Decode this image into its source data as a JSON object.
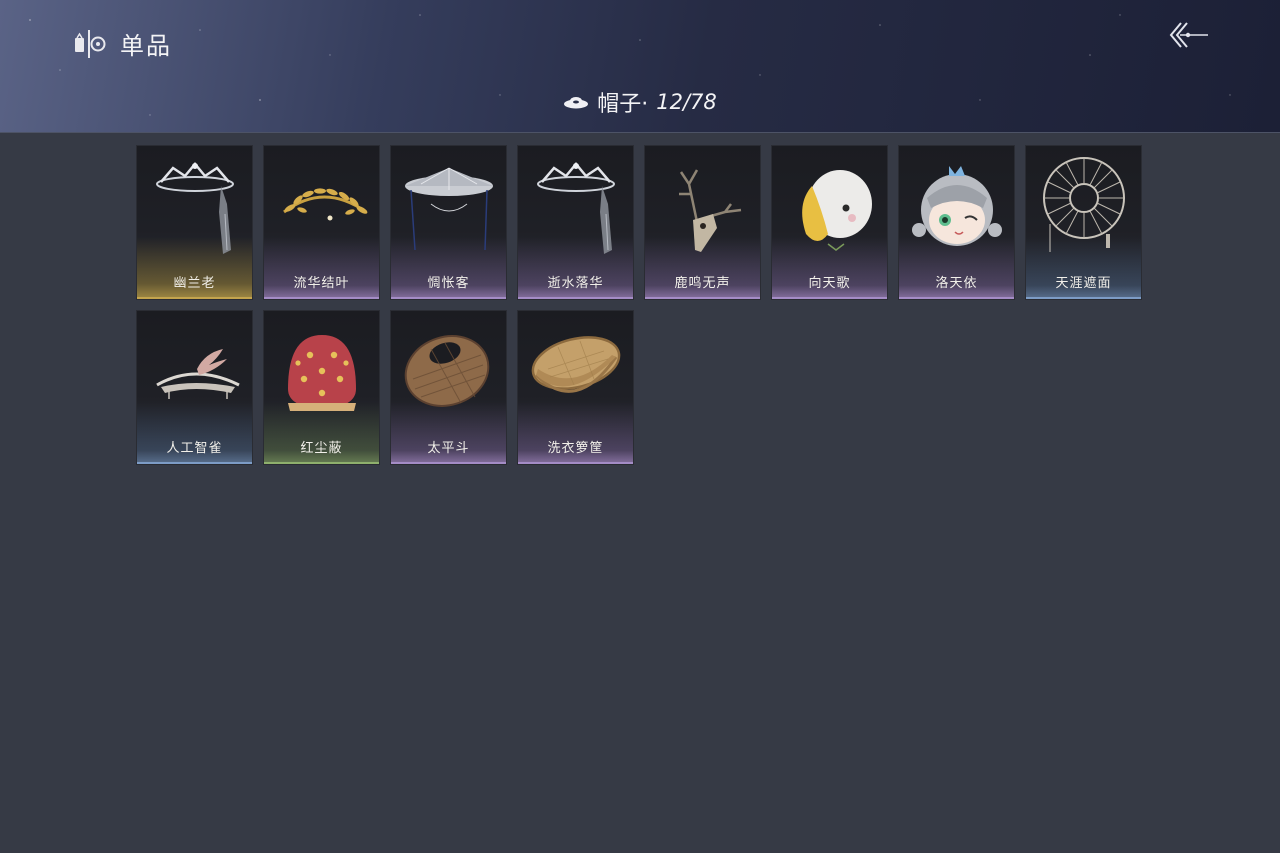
{
  "header": {
    "title": "单品",
    "logo_icon": "wardrobe-logo-icon",
    "back_icon": "back-arrow-icon"
  },
  "category": {
    "icon": "hat-icon",
    "label": "帽子·",
    "count": "12/78"
  },
  "items": [
    {
      "name": "幽兰老",
      "rarity": "gold",
      "icon": "veil-crown-hat"
    },
    {
      "name": "流华结叶",
      "rarity": "purple",
      "icon": "golden-leaf-circlet"
    },
    {
      "name": "惆怅客",
      "rarity": "purple",
      "icon": "white-bamboo-hat"
    },
    {
      "name": "逝水落华",
      "rarity": "purple",
      "icon": "veil-crown-hat"
    },
    {
      "name": "鹿鸣无声",
      "rarity": "purple",
      "icon": "antler-skull"
    },
    {
      "name": "向天歌",
      "rarity": "purple",
      "icon": "goose-plush-hat"
    },
    {
      "name": "洛天依",
      "rarity": "purple",
      "icon": "luo-tianyi-plush-hat"
    },
    {
      "name": "天涯遮面",
      "rarity": "blue",
      "icon": "round-wire-hat"
    },
    {
      "name": "人工智雀",
      "rarity": "blue",
      "icon": "bird-hat"
    },
    {
      "name": "红尘蔽",
      "rarity": "green",
      "icon": "red-hood"
    },
    {
      "name": "太平斗",
      "rarity": "purple",
      "icon": "woven-basket-hat"
    },
    {
      "name": "洗衣箩筐",
      "rarity": "purple",
      "icon": "laundry-basket"
    }
  ]
}
